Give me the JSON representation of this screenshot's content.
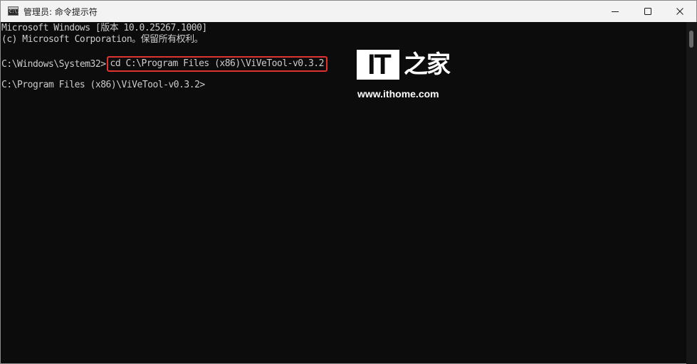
{
  "window": {
    "title": "管理员: 命令提示符",
    "app_icon_text": "C:\\."
  },
  "console": {
    "line1": "Microsoft Windows [版本 10.0.25267.1000]",
    "line2": "(c) Microsoft Corporation。保留所有权利。",
    "prompt1": "C:\\Windows\\System32>",
    "command": "cd C:\\Program Files (x86)\\ViVeTool-v0.3.2",
    "prompt2": "C:\\Program Files (x86)\\ViVeTool-v0.3.2>"
  },
  "watermark": {
    "logo_it": "IT",
    "logo_cn": "之家",
    "url": "www.ithome.com"
  },
  "colors": {
    "console_bg": "#0c0c0c",
    "console_text": "#cccccc",
    "highlight_border": "#e0332f",
    "titlebar_bg": "#f3f3f3"
  }
}
